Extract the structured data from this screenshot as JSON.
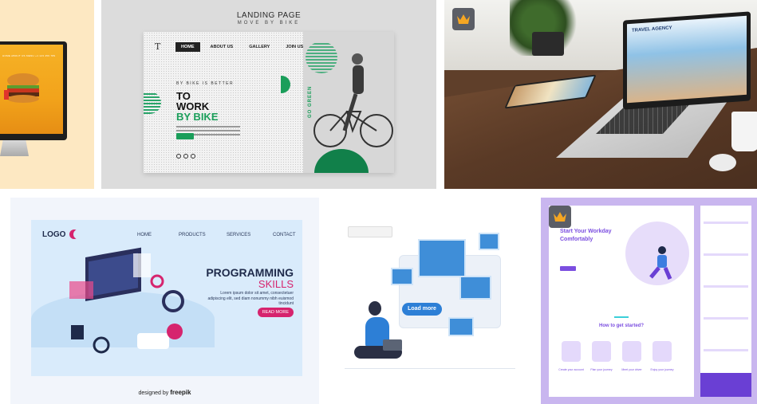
{
  "tiles": {
    "burger": {
      "nav_text": "HOME  ABOUT US  MENU  +1 123 456 789"
    },
    "bike": {
      "title": "LANDING PAGE",
      "subtitle": "MOVE BY BIKE",
      "menu": [
        "HOME",
        "ABOUT US",
        "GALLERY",
        "JOIN US"
      ],
      "tagline": "BY BIKE IS BETTER",
      "headline_1": "TO",
      "headline_2": "WORK",
      "headline_3": "BY BIKE",
      "button": "Read More",
      "side_text": "GO GREEN"
    },
    "travel": {
      "site_title": "TRAVEL AGENCY"
    },
    "programming": {
      "logo": "LOGO",
      "nav": [
        "HOME",
        "PRODUCTS",
        "SERVICES",
        "CONTACT"
      ],
      "headline_1": "PROGRAMMING",
      "headline_2": "SKILLS",
      "body": "Lorem ipsum dolor sit amet, consectetuer adipiscing elit, sed diam nonummy nibh euismod tincidunt",
      "button": "READ MORE",
      "credit_prefix": "designed by",
      "credit_brand": "freepik"
    },
    "load_more": {
      "button": "Load more"
    },
    "workday": {
      "headline": "Start Your Workday Comfortably",
      "section_title": "How to get started?",
      "steps": [
        "Create your account",
        "Plan your journey",
        "Meet your driver",
        "Enjoy your journey"
      ]
    }
  },
  "colors": {
    "premium_badge": "#5b5e66",
    "crown": "#f5a623",
    "bike_green": "#1a9e5a",
    "programming_pink": "#d6246e",
    "load_more_blue": "#2d7fd6",
    "workday_purple": "#7b4ee0"
  },
  "icons": {
    "premium": "crown-icon"
  }
}
